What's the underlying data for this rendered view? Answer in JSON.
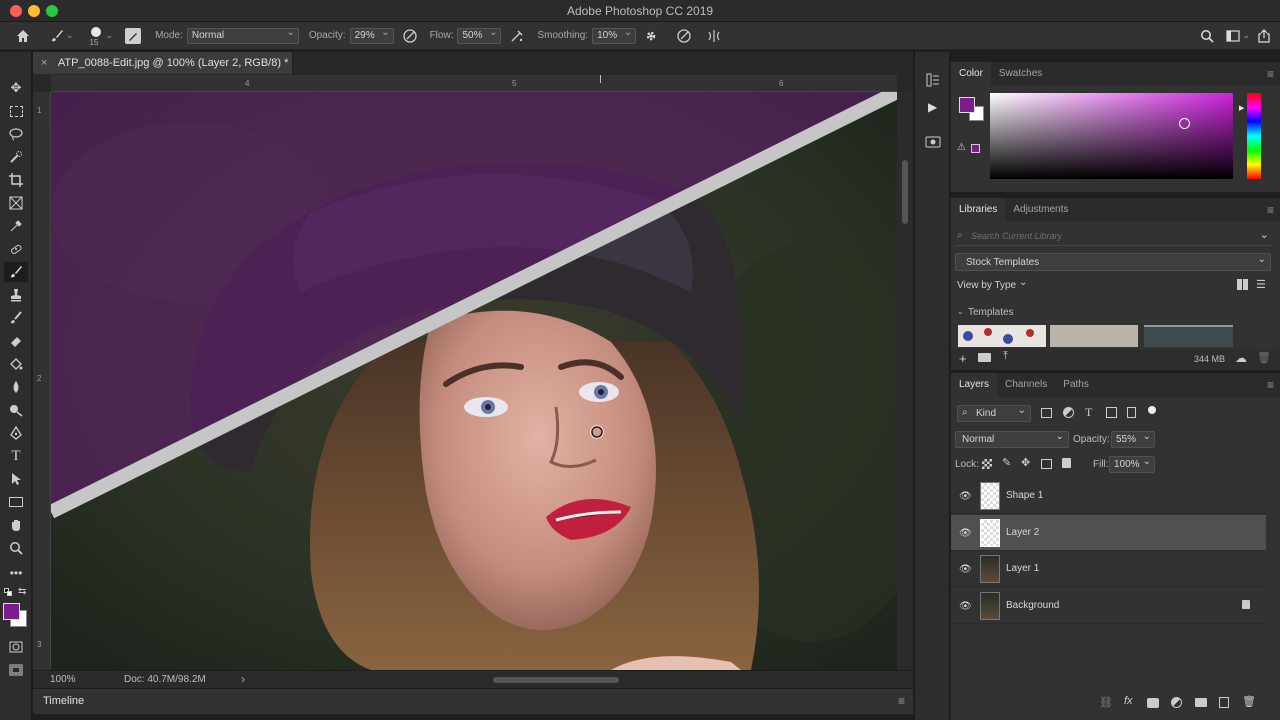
{
  "app": {
    "window_title": "Adobe Photoshop CC 2019",
    "traffic_colors": [
      "#fe5f57",
      "#febc2e",
      "#28c840"
    ]
  },
  "options_bar": {
    "brush_size": "15",
    "mode_label": "Mode:",
    "mode_value": "Normal",
    "opacity_label": "Opacity:",
    "opacity_value": "29%",
    "flow_label": "Flow:",
    "flow_value": "50%",
    "smoothing_label": "Smoothing:",
    "smoothing_value": "10%"
  },
  "document": {
    "tab_title": "ATP_0088-Edit.jpg @ 100% (Layer 2, RGB/8) *",
    "ruler_top": [
      "4",
      "5",
      "6"
    ],
    "ruler_left": [
      "1",
      "2",
      "3"
    ],
    "zoom": "100%",
    "doc_size": "Doc: 40.7M/98.2M"
  },
  "timeline": {
    "label": "Timeline"
  },
  "color_panel": {
    "tabs": [
      "Color",
      "Swatches"
    ],
    "foreground": "#7a1e8c",
    "background": "#ffffff",
    "hue_color": "#cc22dd"
  },
  "libraries_panel": {
    "tabs": [
      "Libraries",
      "Adjustments"
    ],
    "search_placeholder": "Search Current Library",
    "library_name": "Stock Templates",
    "view_by": "View by Type",
    "section": "Templates",
    "storage": "344 MB"
  },
  "layers_panel": {
    "tabs": [
      "Layers",
      "Channels",
      "Paths"
    ],
    "filter_kind": "Kind",
    "blend_mode": "Normal",
    "opacity_label": "Opacity:",
    "opacity_value": "55%",
    "lock_label": "Lock:",
    "fill_label": "Fill:",
    "fill_value": "100%",
    "layers": [
      {
        "name": "Shape 1",
        "selected": false,
        "locked": false
      },
      {
        "name": "Layer 2",
        "selected": true,
        "locked": false
      },
      {
        "name": "Layer 1",
        "selected": false,
        "locked": false
      },
      {
        "name": "Background",
        "selected": false,
        "locked": true
      }
    ]
  },
  "icons": [
    "home-icon",
    "brush-icon",
    "pressure-opacity-icon",
    "airbrush-icon",
    "gear-icon",
    "pressure-size-icon",
    "symmetry-icon",
    "search-icon",
    "workspace-icon",
    "share-icon"
  ]
}
